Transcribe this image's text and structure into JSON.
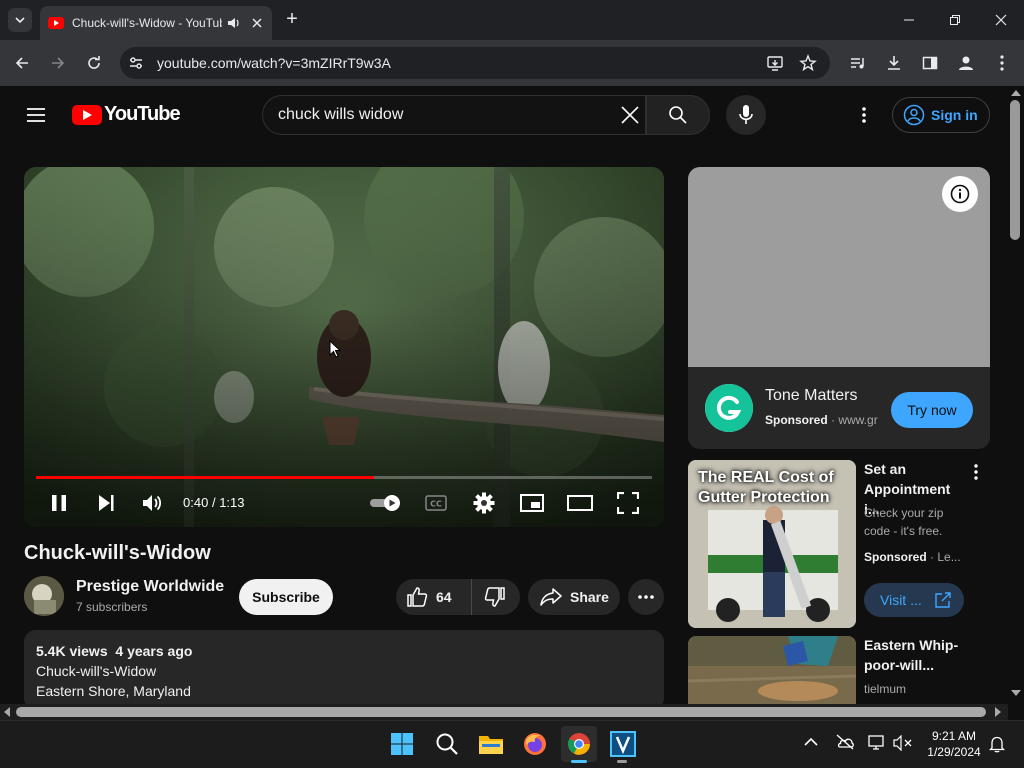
{
  "browser": {
    "tab_title": "Chuck-will's-Widow - YouTube",
    "url": "youtube.com/watch?v=3mZIRrT9w3A"
  },
  "youtube": {
    "logo_text": "YouTube",
    "search_value": "chuck wills widow",
    "sign_in_label": "Sign in"
  },
  "player": {
    "time_current": "0:40",
    "time_separator": "/",
    "time_total": "1:13",
    "progress_fraction": 0.548
  },
  "video": {
    "title": "Chuck-will's-Widow",
    "channel": "Prestige Worldwide",
    "subscribers": "7 subscribers",
    "subscribe_label": "Subscribe",
    "likes": "64",
    "share_label": "Share",
    "views": "5.4K views",
    "age": "4 years ago",
    "desc_line1": "Chuck-will's-Widow",
    "desc_line2": "Eastern Shore, Maryland"
  },
  "ad": {
    "title": "Tone Matters",
    "sponsored": "Sponsored",
    "domain": "www.gr",
    "button": "Try now"
  },
  "recommended": [
    {
      "thumb_text": "The REAL Cost of Gutter Protection",
      "title": "Set an Appointment i...",
      "desc": "Check your zip code - it's free.",
      "sponsored": "Sponsored",
      "domain": "Le...",
      "button": "Visit ..."
    },
    {
      "title": "Eastern Whip-poor-will...",
      "channel": "tielmum"
    }
  ],
  "taskbar": {
    "time": "9:21 AM",
    "date": "1/29/2024"
  },
  "colors": {
    "accent_red": "#ff0000",
    "link_blue": "#3ea6ff",
    "background": "#0f0f0f"
  }
}
